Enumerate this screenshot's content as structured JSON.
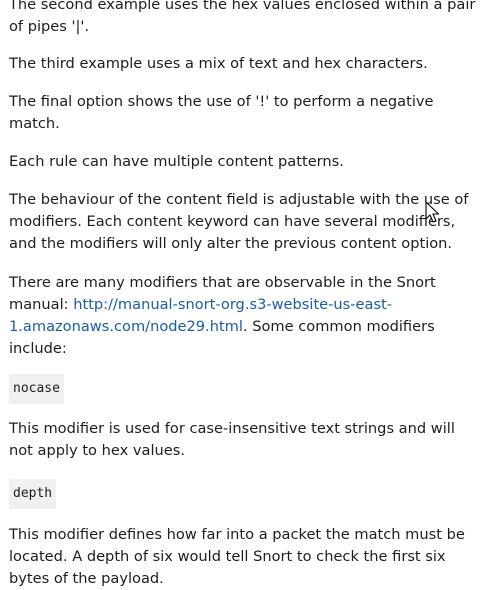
{
  "article": {
    "p_second_example": "The second example uses the hex values enclosed within a pair of pipes '|'.",
    "p_third_example": "The third example uses a mix of text and hex characters.",
    "p_final_option": "The final option shows the use of '!' to perform a negative match.",
    "p_multiple_patterns": "Each rule can have multiple content patterns.",
    "p_behaviour": "The behaviour of the content field is adjustable with the use of modifiers. Each content keyword can have several modifiers, and the modifiers will only alter the previous content option.",
    "p_many_modifiers": {
      "before": "There are many modifiers that are observable in the Snort manual: ",
      "link_text": "http://manual-snort-org.s3-website-us-east-1.amazonaws.com/node29.html",
      "after": ". Some common modifiers include:"
    },
    "code_nocase": "nocase",
    "p_nocase_desc": "This modifier is used for case-insensitive text strings and will not apply to hex values.",
    "code_depth": "depth",
    "p_depth_desc": "This modifier defines how far into a packet the match must be located. A depth of six would tell Snort to check the first six bytes of the payload."
  },
  "colors": {
    "text": "#1d1d1d",
    "link": "#1a5ca8",
    "code_background": "#eef0f2"
  },
  "icons": {
    "cursor": "mouse-pointer-icon"
  }
}
